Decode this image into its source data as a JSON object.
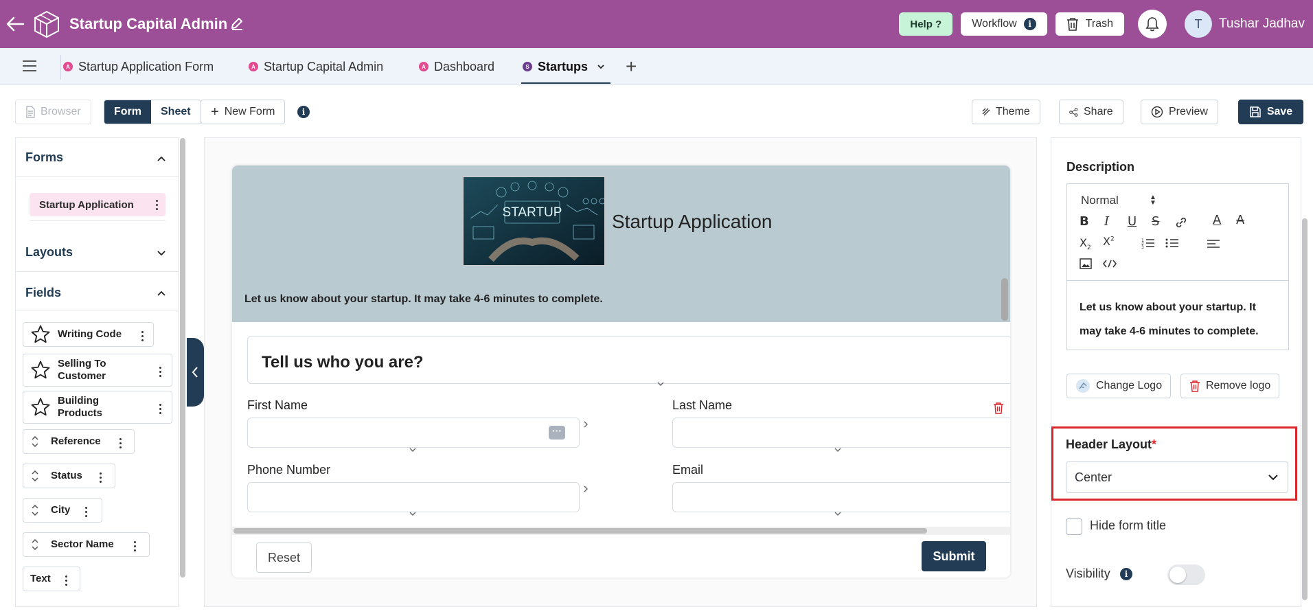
{
  "header": {
    "app_title": "Startup Capital Admin",
    "help_label": "Help ?",
    "workflow_label": "Workflow",
    "trash_label": "Trash",
    "user_initial": "T",
    "user_name": "Tushar Jadhav"
  },
  "tabs": [
    {
      "label": "Startup Application Form",
      "badge": "A"
    },
    {
      "label": "Startup Capital Admin",
      "badge": "A"
    },
    {
      "label": "Dashboard",
      "badge": "A"
    },
    {
      "label": "Startups",
      "badge": "S",
      "active": true
    }
  ],
  "toolbar": {
    "browser_label": "Browser",
    "form_label": "Form",
    "sheet_label": "Sheet",
    "new_form_label": "New Form",
    "theme_label": "Theme",
    "share_label": "Share",
    "preview_label": "Preview",
    "save_label": "Save"
  },
  "sidebar": {
    "forms_heading": "Forms",
    "form_item": "Startup Application",
    "layouts_heading": "Layouts",
    "fields_heading": "Fields",
    "fields": [
      {
        "label": "Writing Code",
        "icon": "star-icon"
      },
      {
        "label": "Selling To Customer",
        "icon": "star-icon"
      },
      {
        "label": "Building Products",
        "icon": "star-icon"
      },
      {
        "label": "Reference",
        "icon": "sort-icon"
      },
      {
        "label": "Status",
        "icon": "sort-icon"
      },
      {
        "label": "City",
        "icon": "sort-icon"
      },
      {
        "label": "Sector Name",
        "icon": "sort-icon"
      },
      {
        "label": "Text",
        "icon": ""
      }
    ]
  },
  "form": {
    "title": "Startup Application",
    "image_text": "STARTUP",
    "description": "Let us know about your startup. It may take 4-6 minutes to complete.",
    "section_title": "Tell us who you are?",
    "first_name": "First Name",
    "last_name": "Last Name",
    "phone": "Phone Number",
    "email": "Email",
    "reset_label": "Reset",
    "submit_label": "Submit"
  },
  "panel": {
    "description_label": "Description",
    "editor_style": "Normal",
    "editor_text": "Let us know about your startup. It may take 4-6 minutes to complete.",
    "change_logo": "Change Logo",
    "remove_logo": "Remove logo",
    "header_layout_label": "Header Layout",
    "required_mark": "*",
    "header_layout_value": "Center",
    "hide_title_label": "Hide form title",
    "visibility_label": "Visibility",
    "visibility_on": false
  },
  "colors": {
    "topbar": "#9c4f96",
    "primary": "#213c54",
    "highlight": "#d9262a"
  }
}
